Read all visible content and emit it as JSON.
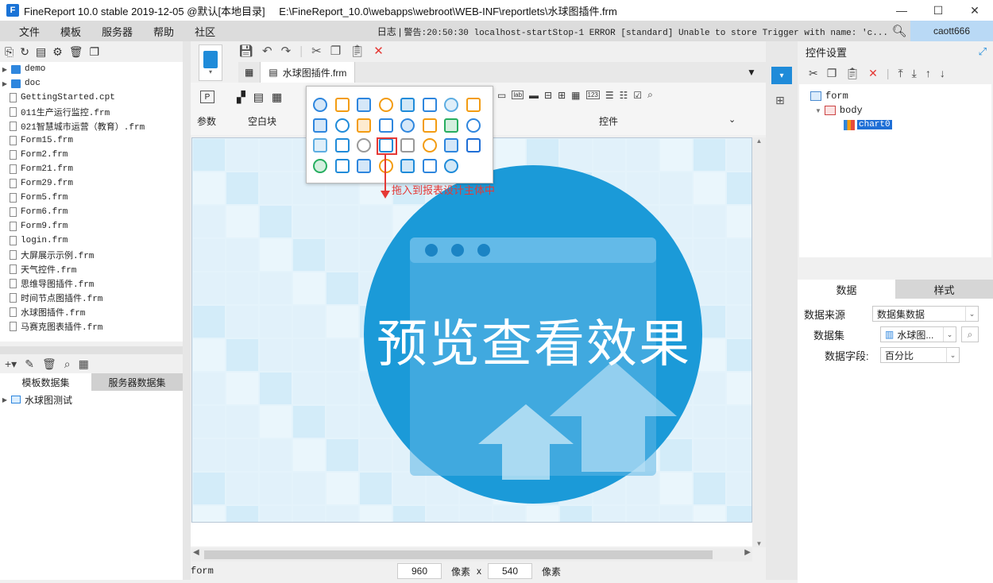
{
  "window": {
    "app_title": "FineReport 10.0 stable 2019-12-05 @默认[本地目录]",
    "path": "E:\\FineReport_10.0\\webapps\\webroot\\WEB-INF\\reportlets\\水球图插件.frm",
    "logo_letter": "F"
  },
  "menu": {
    "items": [
      "文件",
      "模板",
      "服务器",
      "帮助",
      "社区"
    ],
    "log_label": "日志",
    "log_text": "警告:20:50:30 localhost-startStop-1 ERROR [standard] Unable to store Trigger with name: 'c...",
    "user": "caott666"
  },
  "file_tree": {
    "folders": [
      "demo",
      "doc"
    ],
    "files": [
      "GettingStarted.cpt",
      "011生产运行监控.frm",
      "021智慧城市运营（教育）.frm",
      "Form15.frm",
      "Form2.frm",
      "Form21.frm",
      "Form29.frm",
      "Form5.frm",
      "Form6.frm",
      "Form9.frm",
      "login.frm",
      "大屏展示示例.frm",
      "天气控件.frm",
      "思维导图插件.frm",
      "时间节点图插件.frm",
      "水球图插件.frm",
      "马赛克图表插件.frm"
    ]
  },
  "datasets": {
    "tabs": [
      "模板数据集",
      "服务器数据集"
    ],
    "items": [
      "水球图测试"
    ]
  },
  "editor": {
    "tab_label": "水球图插件.frm",
    "group_param": "参数",
    "group_blank": "空白块",
    "group_widget": "控件",
    "widget_lab": "lab",
    "widget_123": "123"
  },
  "popup": {
    "hint": "拖入到报表设计主体中"
  },
  "canvas": {
    "overlay_text": "预览查看效果"
  },
  "status": {
    "current": "form",
    "width": "960",
    "unit1": "像素",
    "times": "x",
    "height": "540",
    "unit2": "像素"
  },
  "right_panel": {
    "title": "控件设置",
    "tree": [
      "form",
      "body",
      "chart0"
    ],
    "tabs": [
      "数据",
      "样式"
    ],
    "source_label": "数据来源",
    "source_value": "数据集数据",
    "dataset_label": "数据集",
    "dataset_value": "水球图...",
    "field_label": "数据字段:",
    "field_value": "百分比"
  },
  "colors": {
    "accent": "#1f8bd9",
    "selection": "#1f6fd6",
    "circle": "#1b9ad8",
    "highlight": "#e53935"
  }
}
